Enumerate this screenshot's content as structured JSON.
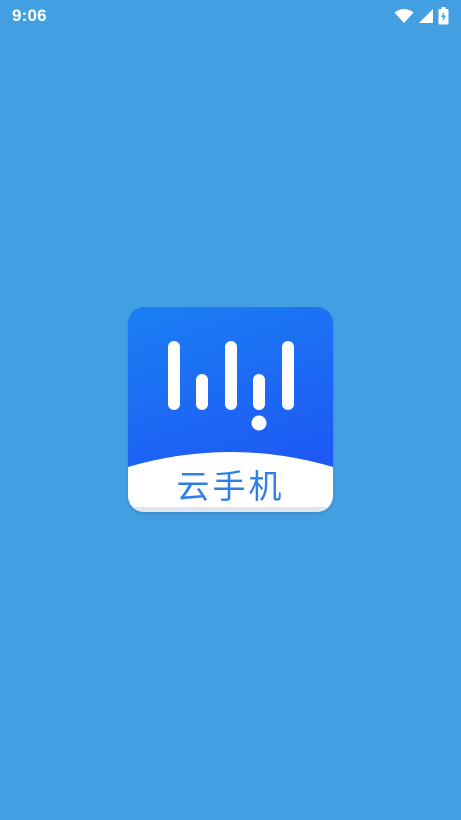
{
  "status_bar": {
    "time": "9:06",
    "icons": [
      "wifi-icon",
      "cellular-signal-icon",
      "battery-charging-icon"
    ]
  },
  "splash": {
    "app_label": "云手机"
  },
  "colors": {
    "background": "#429fe1",
    "icon_gradient_top": "#1b7ff3",
    "icon_gradient_bottom": "#1e57f5",
    "label_text": "#2f7fe6"
  }
}
